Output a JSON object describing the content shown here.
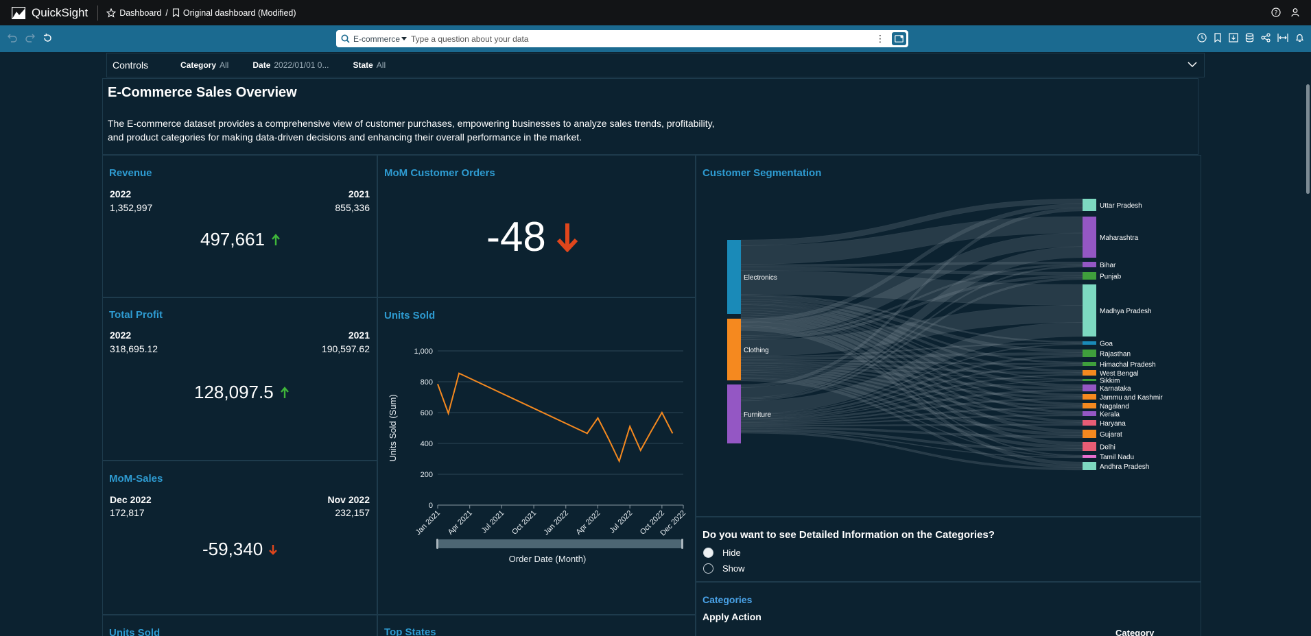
{
  "app": {
    "name": "QuickSight",
    "breadcrumb_dashboard": "Dashboard",
    "breadcrumb_separator": "/",
    "dashboard_title": "Original dashboard (Modified)"
  },
  "search": {
    "source": "E-commerce",
    "placeholder": "Type a question about your data"
  },
  "controls": {
    "title": "Control s",
    "title_text": "Controls",
    "filters": [
      {
        "label": "Category",
        "value": "All"
      },
      {
        "label": "Date",
        "value": "2022/01/01 0..."
      },
      {
        "label": "State",
        "value": "All"
      }
    ]
  },
  "header": {
    "title": "E-Commerce Sales Overview",
    "description": "The E-commerce dataset provides a comprehensive view of customer purchases, empowering businesses to analyze sales trends, profitability, and product categories for making data-driven decisions and enhancing their overall performance in the market."
  },
  "kpis": {
    "revenue": {
      "title": "Revenue",
      "cur_label": "2022",
      "cur_value": "1,352,997",
      "prev_label": "2021",
      "prev_value": "855,336",
      "diff": "497,661",
      "trend": "up"
    },
    "mom_orders": {
      "title": "MoM Customer Orders",
      "value": "-48",
      "trend": "down"
    },
    "profit": {
      "title": "Total Profit",
      "cur_label": "2022",
      "cur_value": "318,695.12",
      "prev_label": "2021",
      "prev_value": "190,597.62",
      "diff": "128,097.5",
      "trend": "up"
    },
    "mom_sales": {
      "title": "MoM-Sales",
      "cur_label": "Dec 2022",
      "cur_value": "172,817",
      "prev_label": "Nov 2022",
      "prev_value": "232,157",
      "diff": "-59,340",
      "trend": "down"
    },
    "units_sold_bottom": {
      "title": "Units Sold"
    },
    "top_states": {
      "title": "Top States"
    }
  },
  "units_chart": {
    "title": "Units Sold",
    "x_tick_labels": [
      "Jan 2021",
      "Apr 2021",
      "Jul 2021",
      "Oct 2021",
      "Jan 2022",
      "Apr 2022",
      "Jul 2022",
      "Oct 2022",
      "Dec 2022"
    ],
    "y_tick_labels": [
      "0",
      "200",
      "400",
      "600",
      "800",
      "1,000"
    ]
  },
  "chart_data": {
    "type": "line",
    "title": "Units Sold",
    "xlabel": "Order Date (Month)",
    "ylabel": "Units Sold (Sum)",
    "ylim": [
      0,
      1000
    ],
    "grid": true,
    "x": [
      "2021-01",
      "2021-02",
      "2021-03",
      "2022-03",
      "2022-04",
      "2022-05",
      "2022-06",
      "2022-07",
      "2022-08",
      "2022-09",
      "2022-10",
      "2022-11",
      "2022-12"
    ],
    "series": [
      {
        "values": [
          785,
          595,
          855,
          465,
          565,
          430,
          285,
          510,
          355,
          480,
          600,
          465
        ],
        "x": [
          "2021-01",
          "2021-02",
          "2021-03",
          "2022-03",
          "2022-04",
          "2022-05",
          "2022-06",
          "2022-07",
          "2022-08",
          "2022-09",
          "2022-10",
          "2022-11"
        ]
      }
    ],
    "color": "#f5891f"
  },
  "segmentation": {
    "title": "Customer Segmentation",
    "sources": [
      {
        "name": "Electronics",
        "color": "#1a8ab8"
      },
      {
        "name": "Clothing",
        "color": "#f5891f"
      },
      {
        "name": "Furniture",
        "color": "#9457c4"
      }
    ],
    "targets": [
      {
        "name": "Uttar Pradesh",
        "color": "#7dd9c1"
      },
      {
        "name": "Maharashtra",
        "color": "#9457c4"
      },
      {
        "name": "Bihar",
        "color": "#9457c4"
      },
      {
        "name": "Punjab",
        "color": "#3f9f3c"
      },
      {
        "name": "Madhya Pradesh",
        "color": "#7dd9c1"
      },
      {
        "name": "Goa",
        "color": "#1a8ab8"
      },
      {
        "name": "Rajasthan",
        "color": "#3f9f3c"
      },
      {
        "name": "Himachal Pradesh",
        "color": "#3f9f3c"
      },
      {
        "name": "West Bengal",
        "color": "#f5891f"
      },
      {
        "name": "Sikkim",
        "color": "#3f9f3c"
      },
      {
        "name": "Karnataka",
        "color": "#9457c4"
      },
      {
        "name": "Jammu and Kashmir",
        "color": "#f5891f"
      },
      {
        "name": "Nagaland",
        "color": "#f5891f"
      },
      {
        "name": "Kerala",
        "color": "#9457c4"
      },
      {
        "name": "Haryana",
        "color": "#e85d75"
      },
      {
        "name": "Gujarat",
        "color": "#f5891f"
      },
      {
        "name": "Delhi",
        "color": "#e85d75"
      },
      {
        "name": "Tamil Nadu",
        "color": "#e86fd0"
      },
      {
        "name": "Andhra Pradesh",
        "color": "#7dd9c1"
      }
    ]
  },
  "details": {
    "question": "Do you want to see Detailed Information on the Categories?",
    "options": [
      "Hide",
      "Show"
    ],
    "selected": "Hide"
  },
  "categories": {
    "title": "Categories",
    "subtitle": "Apply Action",
    "column": "Category"
  },
  "colors": {
    "accent": "#2e9bd1",
    "up": "#3fb63a",
    "down": "#e0461c",
    "toolbar": "#1b6a90"
  }
}
